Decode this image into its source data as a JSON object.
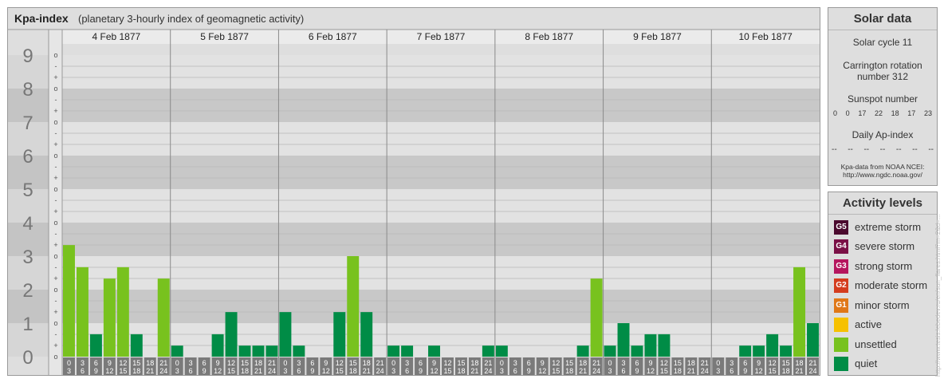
{
  "title": "Kpa-index",
  "subtitle": "(planetary 3-hourly index of geomagnetic activity)",
  "chart_data": {
    "type": "bar",
    "title": "Kpa-index",
    "subtitle": "(planetary 3-hourly index of geomagnetic activity)",
    "ylim": [
      0,
      9
    ],
    "y_ticks": [
      "0",
      "1",
      "2",
      "3",
      "4",
      "5",
      "6",
      "7",
      "8",
      "9"
    ],
    "minor_tick_marks": [
      "o",
      "+",
      "-"
    ],
    "days": [
      "4 Feb 1877",
      "5 Feb 1877",
      "6 Feb 1877",
      "7 Feb 1877",
      "8 Feb 1877",
      "9 Feb 1877",
      "10 Feb 1877"
    ],
    "interval_start": [
      "0",
      "3",
      "6",
      "9",
      "12",
      "15",
      "18",
      "21"
    ],
    "interval_end": [
      "3",
      "6",
      "9",
      "12",
      "15",
      "18",
      "21",
      "24"
    ],
    "values": [
      [
        3.33,
        2.67,
        0.67,
        2.33,
        2.67,
        0.67,
        0,
        2.33
      ],
      [
        0.33,
        0,
        0,
        0.67,
        1.33,
        0.33,
        0.33,
        0.33
      ],
      [
        1.33,
        0.33,
        0,
        0,
        1.33,
        3,
        1.33,
        0
      ],
      [
        0.33,
        0.33,
        0,
        0.33,
        0,
        0,
        0,
        0.33
      ],
      [
        0.33,
        0,
        0,
        0,
        0,
        0,
        0.33,
        2.33
      ],
      [
        0.33,
        1,
        0.33,
        0.67,
        0.67,
        0,
        0,
        0
      ],
      [
        0,
        0,
        0.33,
        0.33,
        0.67,
        0.33,
        2.67,
        1
      ]
    ],
    "colors": {
      "quiet": "#008c46",
      "unsettled": "#78c21e"
    }
  },
  "solar": {
    "heading": "Solar data",
    "cycle": "Solar cycle 11",
    "carrington_line1": "Carrington rotation",
    "carrington_line2": "number 312",
    "sunspot_label": "Sunspot number",
    "sunspots": [
      "0",
      "0",
      "17",
      "22",
      "18",
      "17",
      "23"
    ],
    "ap_label": "Daily Ap-index",
    "ap_values": [
      "--",
      "--",
      "--",
      "--",
      "--",
      "--",
      "--"
    ],
    "source_line1": "Kpa-data from NOAA NCEI:",
    "source_line2": "http://www.ngdc.noaa.gov/"
  },
  "activity": {
    "heading": "Activity levels",
    "levels": [
      {
        "badge": "G5",
        "label": "extreme storm",
        "color": "#4b0a2e"
      },
      {
        "badge": "G4",
        "label": "severe storm",
        "color": "#7a1046"
      },
      {
        "badge": "G3",
        "label": "strong storm",
        "color": "#b5165e"
      },
      {
        "badge": "G2",
        "label": "moderate storm",
        "color": "#d43c1e"
      },
      {
        "badge": "G1",
        "label": "minor storm",
        "color": "#e07818"
      },
      {
        "badge": "",
        "label": "active",
        "color": "#f6c100"
      },
      {
        "badge": "",
        "label": "unsettled",
        "color": "#78c21e"
      },
      {
        "badge": "",
        "label": "quiet",
        "color": "#008c46"
      }
    ]
  },
  "watermark": "http://www.tesis.lebedev.ru/en/sun_flares.html?m=2&d=..."
}
